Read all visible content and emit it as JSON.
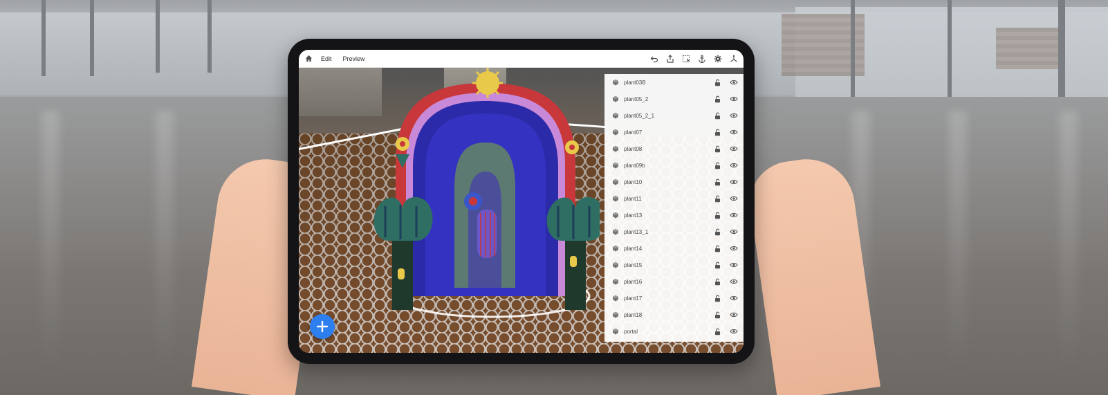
{
  "topbar": {
    "tabs": [
      {
        "label": "Edit"
      },
      {
        "label": "Preview"
      }
    ],
    "tools": [
      "undo-icon",
      "share-icon",
      "select-area-icon",
      "anchor-icon",
      "settings-icon",
      "axes-icon"
    ]
  },
  "layers": [
    {
      "name": "plant03B"
    },
    {
      "name": "plant05_2"
    },
    {
      "name": "plant05_2_1"
    },
    {
      "name": "plant07"
    },
    {
      "name": "plant08"
    },
    {
      "name": "plant09b"
    },
    {
      "name": "plant10"
    },
    {
      "name": "plant11"
    },
    {
      "name": "plant13"
    },
    {
      "name": "plant13_1"
    },
    {
      "name": "plant14"
    },
    {
      "name": "plant15"
    },
    {
      "name": "plant16"
    },
    {
      "name": "plant17"
    },
    {
      "name": "plant18"
    },
    {
      "name": "portal"
    }
  ],
  "colors": {
    "accent": "#2d7ff0",
    "arch": "#2b2aa8",
    "arch_trim": "#c8373a",
    "arch_scallop": "#c88ad8",
    "sun": "#e8c94a",
    "palm": "#2f6e63"
  }
}
